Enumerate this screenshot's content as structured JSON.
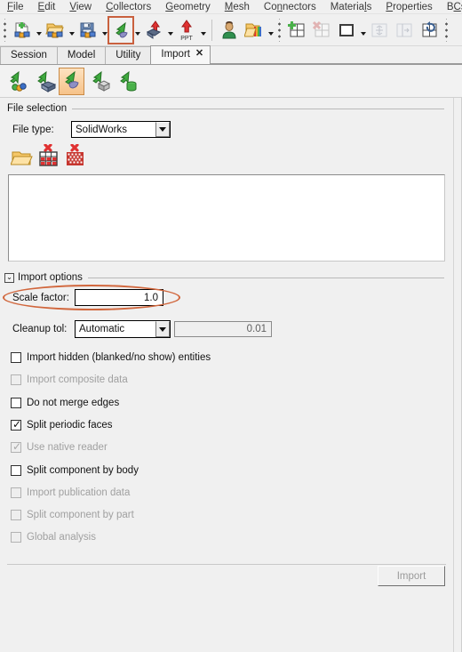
{
  "menubar": {
    "items": [
      {
        "label": "File",
        "mnemonic": "F"
      },
      {
        "label": "Edit",
        "mnemonic": "E"
      },
      {
        "label": "View",
        "mnemonic": "V"
      },
      {
        "label": "Collectors",
        "mnemonic": "C"
      },
      {
        "label": "Geometry",
        "mnemonic": "G"
      },
      {
        "label": "Mesh",
        "mnemonic": "M"
      },
      {
        "label": "Connectors",
        "mnemonic": "n"
      },
      {
        "label": "Materials",
        "mnemonic": "l"
      },
      {
        "label": "Properties",
        "mnemonic": "P"
      },
      {
        "label": "BCs",
        "mnemonic": "C"
      }
    ]
  },
  "toolbar": {
    "buttons": [
      {
        "name": "new-model-icon",
        "tooltip": "New",
        "has_dropdown": true
      },
      {
        "name": "open-model-icon",
        "tooltip": "Open Model",
        "has_dropdown": true
      },
      {
        "name": "save-model-icon",
        "tooltip": "Save Model",
        "has_dropdown": true
      },
      {
        "name": "import-icon",
        "tooltip": "Import",
        "has_dropdown": true,
        "highlighted": true
      },
      {
        "name": "export-icon",
        "tooltip": "Export",
        "has_dropdown": true
      },
      {
        "name": "export-ppt-icon",
        "tooltip": "Export PPT",
        "has_dropdown": true,
        "badge": "PPT"
      },
      {
        "name": "user-profile-icon",
        "tooltip": "User Profiles"
      },
      {
        "name": "load-collectors-icon",
        "tooltip": "Load Collectors",
        "has_dropdown": true
      },
      {
        "name": "add-page-icon",
        "tooltip": "Add Page"
      },
      {
        "name": "delete-page-icon",
        "tooltip": "Delete Page",
        "disabled": true
      },
      {
        "name": "single-window-icon",
        "tooltip": "Window Layout",
        "has_dropdown": true
      },
      {
        "name": "fit-window-icon",
        "tooltip": "Fit Window",
        "disabled": true
      },
      {
        "name": "split-window-icon",
        "tooltip": "Split Window",
        "disabled": true
      },
      {
        "name": "sync-views-icon",
        "tooltip": "Synchronize Views"
      }
    ],
    "highlight_color": "#c9603e",
    "ppt_badge": "PPT"
  },
  "tabs": {
    "items": [
      {
        "label": "Session",
        "active": false,
        "closable": false
      },
      {
        "label": "Model",
        "active": false,
        "closable": false
      },
      {
        "label": "Utility",
        "active": false,
        "closable": false
      },
      {
        "label": "Import",
        "active": true,
        "closable": true
      }
    ],
    "close_glyph": "✕"
  },
  "subtoolbar": {
    "buttons": [
      {
        "name": "import-solver-deck-icon",
        "label": "Import Solver Deck",
        "active": false
      },
      {
        "name": "import-mesh-icon",
        "label": "Import Mesh",
        "active": false
      },
      {
        "name": "import-geometry-icon",
        "label": "Import Geometry",
        "active": true
      },
      {
        "name": "import-connectors-icon",
        "label": "Import Connectors",
        "active": false
      },
      {
        "name": "import-tcl-icon",
        "label": "Import Tcl/Tk",
        "active": false
      }
    ],
    "active_highlight": "#c98a46"
  },
  "file_selection": {
    "group_title": "File selection",
    "file_type_label": "File type:",
    "file_type_value": "SolidWorks",
    "file_type_options": [
      "SolidWorks"
    ],
    "buttons": [
      {
        "name": "open-file-browser-icon",
        "label": "Browse for file"
      },
      {
        "name": "clear-file-table-icon",
        "label": "Clear table"
      },
      {
        "name": "remove-all-files-icon",
        "label": "Remove all files"
      }
    ],
    "file_list_items": []
  },
  "import_options": {
    "group_title": "Import options",
    "collapse_glyph": "⌄",
    "scale_factor_label": "Scale factor:",
    "scale_factor_value": "1.0",
    "cleanup_tol_label": "Cleanup tol:",
    "cleanup_tol_value": "Automatic",
    "cleanup_tol_options": [
      "Automatic"
    ],
    "cleanup_tol_numeric": "0.01",
    "checkboxes": [
      {
        "label": "Import hidden (blanked/no show) entities",
        "checked": false,
        "disabled": false
      },
      {
        "label": "Import composite data",
        "checked": false,
        "disabled": true
      },
      {
        "label": "Do not merge edges",
        "checked": false,
        "disabled": false
      },
      {
        "label": "Split periodic faces",
        "checked": true,
        "disabled": false
      },
      {
        "label": "Use native reader",
        "checked": true,
        "disabled": true
      },
      {
        "label": "Split component by body",
        "checked": false,
        "disabled": false
      },
      {
        "label": "Import publication data",
        "checked": false,
        "disabled": true
      },
      {
        "label": "Split component by part",
        "checked": false,
        "disabled": true
      },
      {
        "label": "Global analysis",
        "checked": false,
        "disabled": true
      }
    ],
    "check_glyph": "✓"
  },
  "footer": {
    "import_button_label": "Import",
    "import_button_disabled": true
  },
  "annotations": [
    {
      "name": "scale-factor-highlight",
      "color": "#d1663c",
      "shape": "ellipse"
    }
  ]
}
